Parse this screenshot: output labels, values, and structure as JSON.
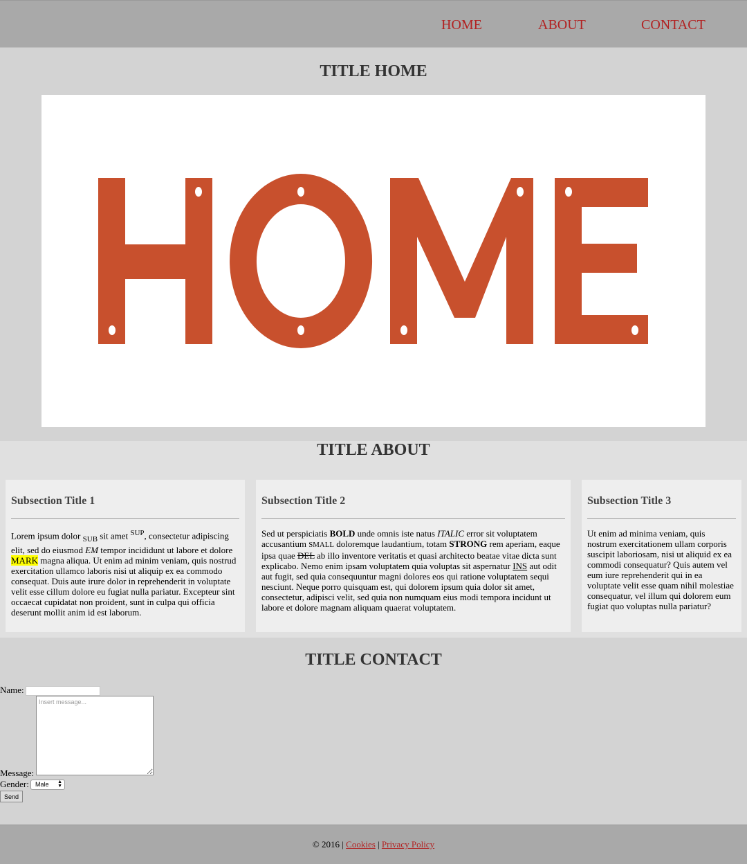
{
  "nav": {
    "items": [
      {
        "label": "HOME"
      },
      {
        "label": "ABOUT"
      },
      {
        "label": "CONTACT"
      }
    ],
    "link_color": "#b22222"
  },
  "home": {
    "title": "TITLE HOME",
    "hero_text": "HOME",
    "hero_color": "#c8502d"
  },
  "about": {
    "title": "TITLE ABOUT",
    "cards": [
      {
        "title": "Subsection Title 1",
        "t1": "Lorem ipsum dolor ",
        "sub": "SUB",
        "t2": " sit amet ",
        "sup": "SUP",
        "t3": ", consectetur adipiscing elit, sed do eiusmod ",
        "em": "EM",
        "t4": " tempor incididunt ut labore et dolore ",
        "mark": "MARK",
        "t5": " magna aliqua. Ut enim ad minim veniam, quis nostrud exercitation ullamco laboris nisi ut aliquip ex ea commodo consequat. Duis aute irure dolor in reprehenderit in voluptate velit esse cillum dolore eu fugiat nulla pariatur. Excepteur sint occaecat cupidatat non proident, sunt in culpa qui officia deserunt mollit anim id est laborum."
      },
      {
        "title": "Subsection Title 2",
        "t1": "Sed ut perspiciatis ",
        "bold": "BOLD",
        "t2": " unde omnis iste natus ",
        "italic": "ITALIC",
        "t3": " error sit voluptatem accusantium ",
        "small": "SMALL",
        "t4": " doloremque laudantium, totam ",
        "strong": "STRONG",
        "t5": " rem aperiam, eaque ipsa quae ",
        "del": "DEL",
        "t6": " ab illo inventore veritatis et quasi architecto beatae vitae dicta sunt explicabo. Nemo enim ipsam voluptatem quia voluptas sit aspernatur ",
        "ins": "INS",
        "t7": " aut odit aut fugit, sed quia consequuntur magni dolores eos qui ratione voluptatem sequi nesciunt. Neque porro quisquam est, qui dolorem ipsum quia dolor sit amet, consectetur, adipisci velit, sed quia non numquam eius modi tempora incidunt ut labore et dolore magnam aliquam quaerat voluptatem."
      },
      {
        "title": "Subsection Title 3",
        "body": "Ut enim ad minima veniam, quis nostrum exercitationem ullam corporis suscipit laboriosam, nisi ut aliquid ex ea commodi consequatur? Quis autem vel eum iure reprehenderit qui in ea voluptate velit esse quam nihil molestiae consequatur, vel illum qui dolorem eum fugiat quo voluptas nulla pariatur?"
      }
    ]
  },
  "contact": {
    "title": "TITLE CONTACT",
    "name_label": "Name:",
    "name_value": "",
    "message_label": "Message:",
    "message_placeholder": "Insert message...",
    "gender_label": "Gender:",
    "gender_selected": "Male",
    "send_label": "Send"
  },
  "footer": {
    "copyright": "© 2016 |",
    "separator": "|",
    "links": [
      {
        "label": "Cookies"
      },
      {
        "label": "Privacy Policy"
      }
    ]
  }
}
